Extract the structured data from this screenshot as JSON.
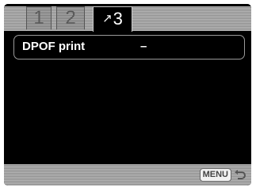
{
  "tabs": [
    {
      "label": "1",
      "active": false
    },
    {
      "label": "2",
      "active": false
    },
    {
      "label": "3",
      "icon": "playback-icon",
      "active": true
    }
  ],
  "menu": {
    "items": [
      {
        "label": "DPOF print",
        "value": "–"
      }
    ]
  },
  "footer": {
    "menu_button_label": "MENU",
    "return_icon": "return-arrow-icon"
  },
  "colors": {
    "background": "#000000",
    "text": "#ffffff",
    "stripe_light": "#b8b8b8",
    "stripe_dark": "#8e8e8e"
  }
}
